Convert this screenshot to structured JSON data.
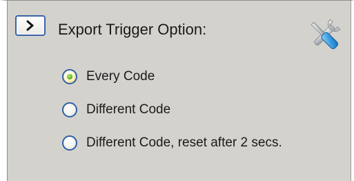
{
  "panel": {
    "title": "Export Trigger Option:",
    "expand_icon": "chevron-right-icon",
    "tools_icon": "tools-icon"
  },
  "options": [
    {
      "label": "Every Code",
      "selected": true
    },
    {
      "label": "Different Code",
      "selected": false
    },
    {
      "label": "Different Code, reset after 2 secs.",
      "selected": false
    }
  ],
  "colors": {
    "panel_bg": "#d4d2cd",
    "radio_border": "#2f5fa7",
    "radio_selected": "#4fae1e",
    "button_border": "#3a64a8"
  }
}
